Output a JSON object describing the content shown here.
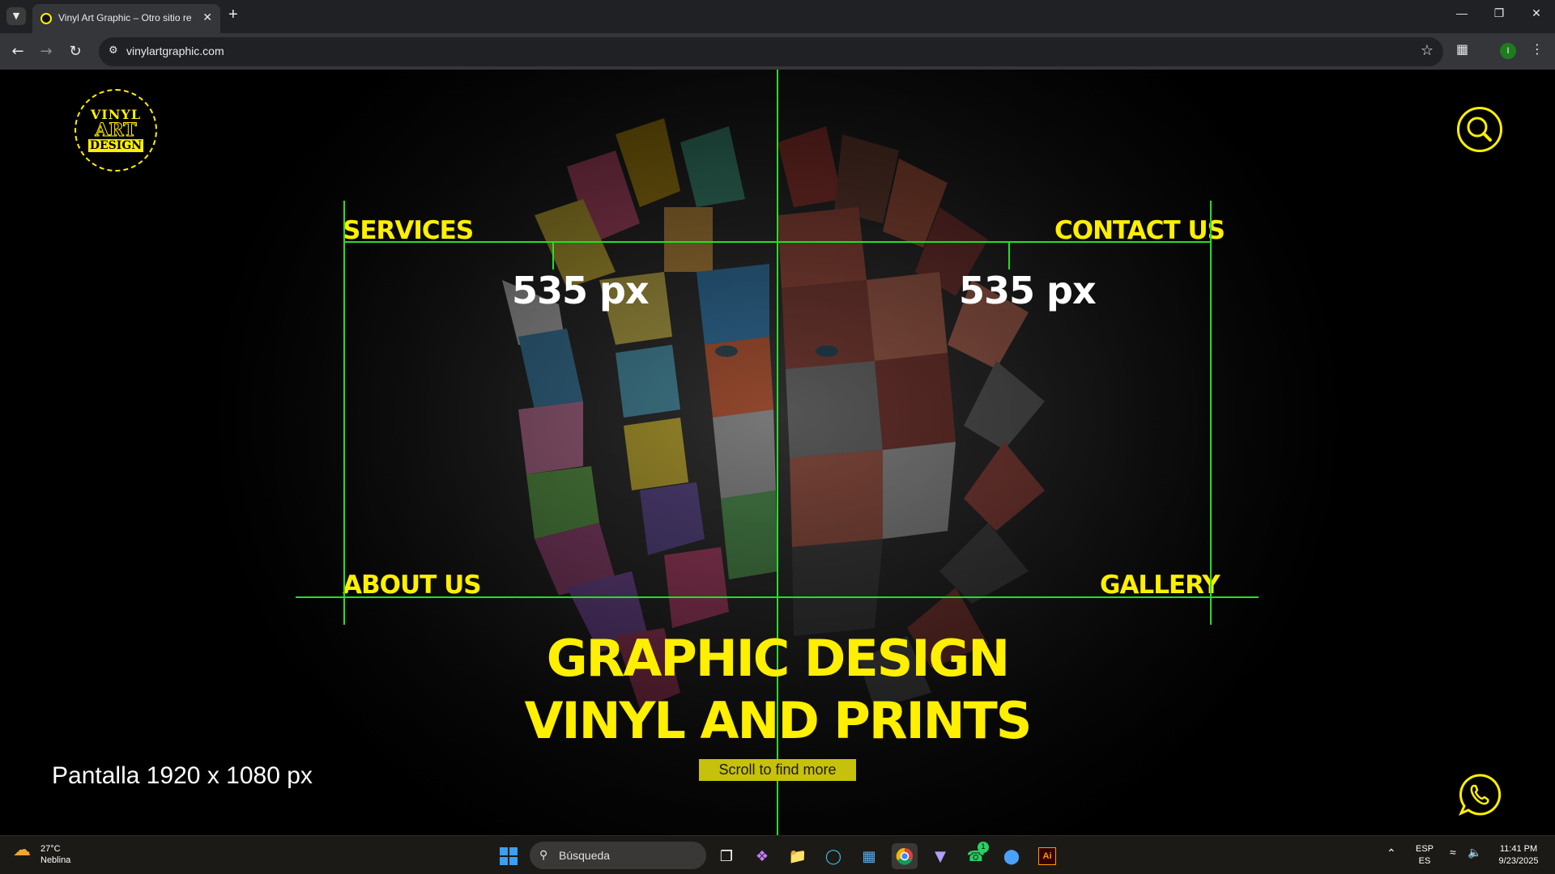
{
  "browser": {
    "tab_title": "Vinyl Art Graphic – Otro sitio re",
    "url": "vinylartgraphic.com",
    "profile_initial": "I"
  },
  "site": {
    "logo": {
      "line1": "VINYL",
      "line2": "ART",
      "line3": "DESIGN"
    },
    "nav": {
      "services": "SERVICES",
      "contact": "CONTACT US",
      "about": "ABOUT US",
      "gallery": "GALLERY"
    },
    "measure_left": "535 px",
    "measure_right": "535 px",
    "hero_line1": "GRAPHIC DESIGN",
    "hero_line2": "VINYL AND PRINTS",
    "scroll_label": "Scroll to find more",
    "screen_label": "Pantalla 1920 x 1080 px"
  },
  "colors": {
    "accent": "#ffef00",
    "guide": "#22e022",
    "scroll_button": "#c6c10a"
  },
  "taskbar": {
    "weather_temp": "27°C",
    "weather_desc": "Neblina",
    "search_placeholder": "Búsqueda",
    "lang_top": "ESP",
    "lang_bottom": "ES",
    "time": "11:41 PM",
    "date": "9/23/2025",
    "whatsapp_badge": "1"
  }
}
